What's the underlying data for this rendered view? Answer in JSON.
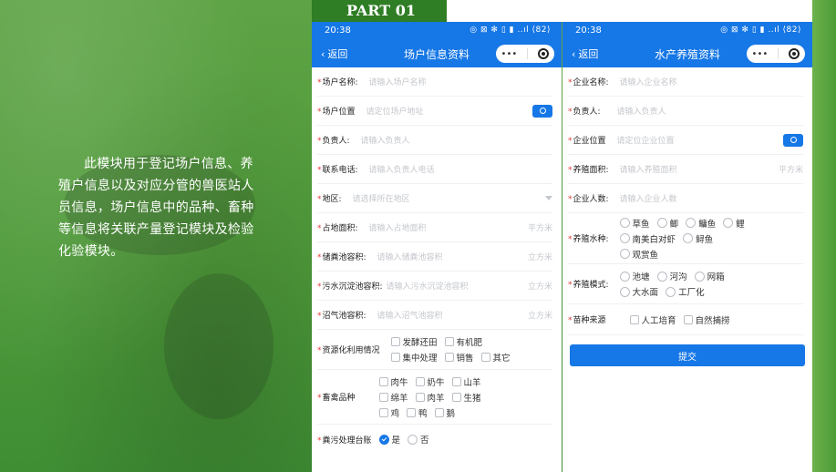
{
  "intro": {
    "text": "此模块用于登记场户信息、养殖户信息以及对应分管的兽医站人员信息，场户信息中的品种、畜种等信息将关联产量登记模块及检验化验模块。"
  },
  "part": {
    "label": "PART 01"
  },
  "status": {
    "time": "20:38",
    "icons": "◎ ⊠ ✻ ▯ ▮ ..ıl ⟨82⟩"
  },
  "common": {
    "back_label": "返回",
    "capsule_dots": "•••"
  },
  "phone1": {
    "title": "场户信息资料",
    "fields": {
      "name": {
        "label": "场户名称:",
        "placeholder": "请输入场户名称"
      },
      "location": {
        "label": "场户位置",
        "placeholder": "请定位场户地址"
      },
      "owner": {
        "label": "负责人:",
        "placeholder": "请输入负责人"
      },
      "phone": {
        "label": "联系电话:",
        "placeholder": "请输入负责人电话"
      },
      "region": {
        "label": "地区:",
        "placeholder": "请选择所在地区"
      },
      "area": {
        "label": "占地面积:",
        "placeholder": "请输入占地面积",
        "unit": "平方米"
      },
      "manure_pool": {
        "label": "储粪池容积:",
        "placeholder": "请输入储粪池容积",
        "unit": "立方米"
      },
      "sewage_pool": {
        "label": "污水沉淀池容积:",
        "placeholder": "请输入污水沉淀池容积",
        "unit": "立方米"
      },
      "biogas_pool": {
        "label": "沼气池容积:",
        "placeholder": "请输入沼气池容积",
        "unit": "立方米"
      }
    },
    "resource_use": {
      "label": "资源化利用情况",
      "options": [
        "发酵还田",
        "有机肥",
        "集中处理",
        "销售",
        "其它"
      ]
    },
    "livestock": {
      "label": "畜禽品种",
      "options": [
        "肉牛",
        "奶牛",
        "山羊",
        "绵羊",
        "肉羊",
        "生猪",
        "鸡",
        "鸭",
        "鹅"
      ]
    },
    "ledger": {
      "label": "粪污处理台账",
      "yes": "是",
      "no": "否"
    }
  },
  "phone2": {
    "title": "水产养殖资料",
    "fields": {
      "company": {
        "label": "企业名称:",
        "placeholder": "请输入企业名称"
      },
      "owner": {
        "label": "负责人:",
        "placeholder": "请输入负责人"
      },
      "location": {
        "label": "企业位置",
        "placeholder": "请定位企业位置"
      },
      "area": {
        "label": "养殖面积:",
        "placeholder": "请输入养殖面积",
        "unit": "平方米"
      },
      "people": {
        "label": "企业人数:",
        "placeholder": "请输入企业人数"
      }
    },
    "species": {
      "label": "养殖水种:",
      "options": [
        "草鱼",
        "鲫",
        "鳙鱼",
        "鲤",
        "南美白对虾",
        "鲟鱼",
        "观赏鱼"
      ]
    },
    "mode": {
      "label": "养殖模式:",
      "options": [
        "池塘",
        "河沟",
        "网箱",
        "大水面",
        "工厂化"
      ]
    },
    "seed": {
      "label": "苗种来源",
      "options": [
        "人工培育",
        "自然捕捞"
      ]
    },
    "submit_label": "提交"
  },
  "colors": {
    "accent": "#1677e6",
    "required": "#e53935",
    "green": "#4f9a3a"
  }
}
